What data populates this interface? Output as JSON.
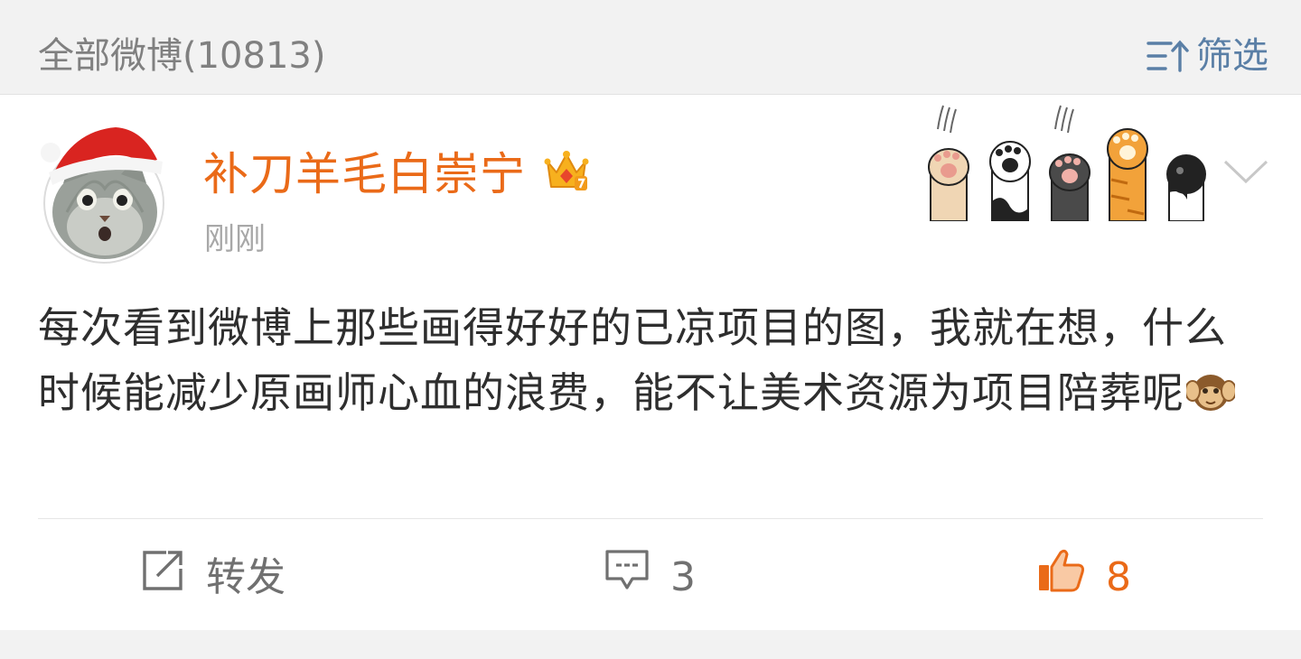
{
  "header": {
    "title": "全部微博(10813)",
    "filter_label": "筛选",
    "filter_icon": "sort-filter-icon",
    "accent_color": "#5a7fa6"
  },
  "post": {
    "avatar": "cat-santa-hat-avatar",
    "username": "补刀羊毛白崇宁",
    "username_color": "#ea6a18",
    "badge": "crown-vip-icon",
    "time": "刚刚",
    "decoration": "cat-paws-banner",
    "menu_icon": "chevron-down-icon",
    "content": "每次看到微博上那些画得好好的已凉项目的图，我就在想，什么时候能减少原画师心血的浪费，能不让美术资源为项目陪葬呢",
    "content_emoji": "monkey-covering-ears-emoji"
  },
  "actions": {
    "repost_label": "转发",
    "comment_count": "3",
    "like_count": "8",
    "like_color": "#ea6a18"
  }
}
